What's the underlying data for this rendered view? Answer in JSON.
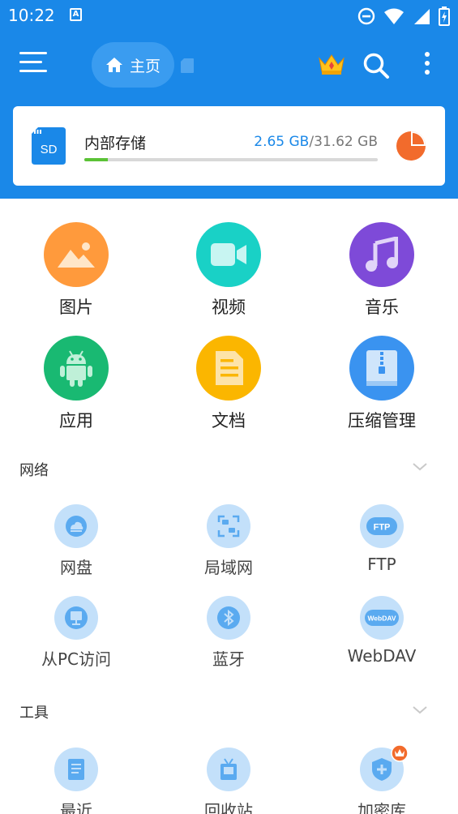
{
  "status_bar": {
    "time": "10:22"
  },
  "app_bar": {
    "home_label": "主页",
    "menu_icon": "hamburger-icon",
    "crown_icon": "crown-icon",
    "search_icon": "search-icon",
    "more_icon": "more-vertical-icon"
  },
  "storage": {
    "name": "内部存储",
    "used": "2.65 GB",
    "separator": "/",
    "total": "31.62 GB",
    "sd_label": "SD",
    "fill_fraction": 0.08,
    "bar_color": "#5bc236"
  },
  "categories": [
    {
      "label": "图片",
      "icon": "image-icon",
      "color": "#ff9a3c"
    },
    {
      "label": "视频",
      "icon": "video-icon",
      "color": "#19d1c6"
    },
    {
      "label": "音乐",
      "icon": "music-icon",
      "color": "#7e4ad8"
    },
    {
      "label": "应用",
      "icon": "android-icon",
      "color": "#19b972"
    },
    {
      "label": "文档",
      "icon": "document-icon",
      "color": "#fbb600"
    },
    {
      "label": "压缩管理",
      "icon": "archive-icon",
      "color": "#3a93f0"
    }
  ],
  "network": {
    "title": "网络",
    "items": [
      {
        "label": "网盘",
        "icon": "cloud-icon"
      },
      {
        "label": "局域网",
        "icon": "lan-icon"
      },
      {
        "label": "FTP",
        "icon": "ftp-icon",
        "icon_text": "FTP"
      },
      {
        "label": "从PC访问",
        "icon": "pc-icon"
      },
      {
        "label": "蓝牙",
        "icon": "bluetooth-icon"
      },
      {
        "label": "WebDAV",
        "icon": "webdav-icon",
        "icon_text": "WebDAV"
      }
    ]
  },
  "tools": {
    "title": "工具",
    "items": [
      {
        "label": "最近",
        "icon": "recent-icon"
      },
      {
        "label": "回收站",
        "icon": "recycle-bin-icon"
      },
      {
        "label": "加密库",
        "icon": "vault-icon"
      }
    ]
  },
  "colors": {
    "primary": "#1a88e8",
    "icon_bg_light": "#c3e0fa",
    "icon_fg": "#5aaaf0"
  }
}
